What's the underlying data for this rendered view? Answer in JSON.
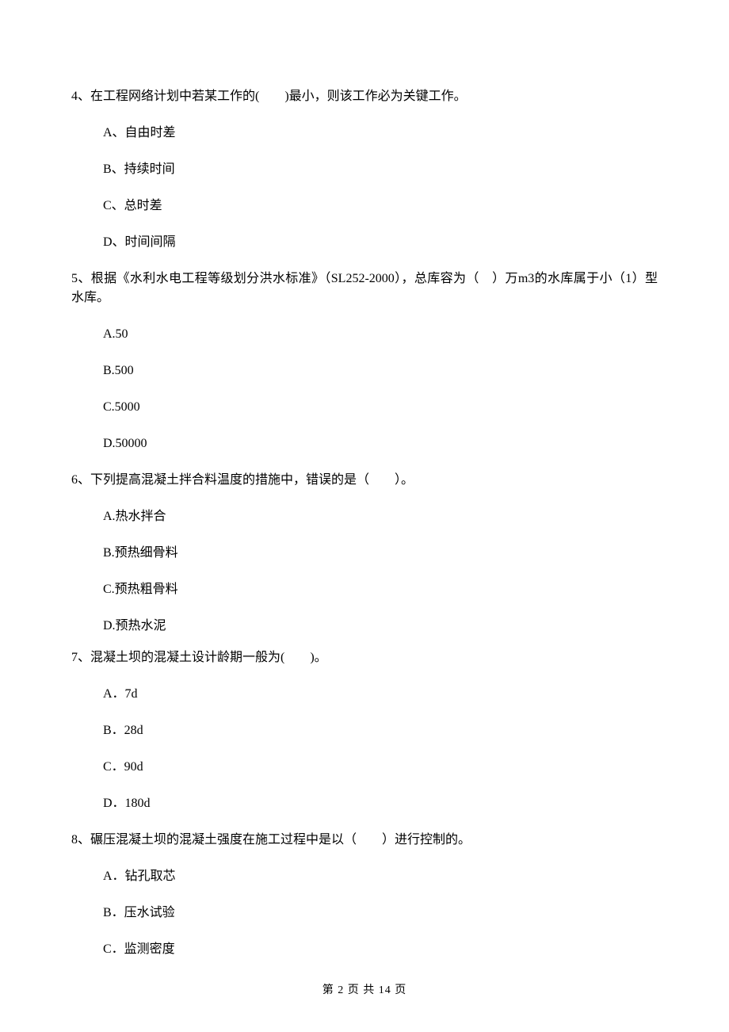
{
  "q4": {
    "stem": "4、在工程网络计划中若某工作的(　　)最小，则该工作必为关键工作。",
    "opts": {
      "A": "A、自由时差",
      "B": "B、持续时间",
      "C": "C、总时差",
      "D": "D、时间间隔"
    }
  },
  "q5": {
    "stem": "5、根据《水利水电工程等级划分洪水标准》（SL252-2000），总库容为（　）万m3的水库属于小（1）型水库。",
    "opts": {
      "A": "A.50",
      "B": "B.500",
      "C": "C.5000",
      "D": "D.50000"
    }
  },
  "q6": {
    "stem": "6、下列提高混凝土拌合料温度的措施中，错误的是（　　）。",
    "opts": {
      "A": "A.热水拌合",
      "B": "B.预热细骨料",
      "C": "C.预热粗骨料",
      "D": "D.预热水泥"
    }
  },
  "q7": {
    "stem": "7、混凝土坝的混凝土设计龄期一般为(　　)。",
    "opts": {
      "A": "A．7d",
      "B": "B．28d",
      "C": "C．90d",
      "D": "D．180d"
    }
  },
  "q8": {
    "stem": "8、碾压混凝土坝的混凝土强度在施工过程中是以（　　）进行控制的。",
    "opts": {
      "A": "A．钻孔取芯",
      "B": "B．压水试验",
      "C": "C．监测密度"
    }
  },
  "footer": "第 2 页 共 14 页"
}
